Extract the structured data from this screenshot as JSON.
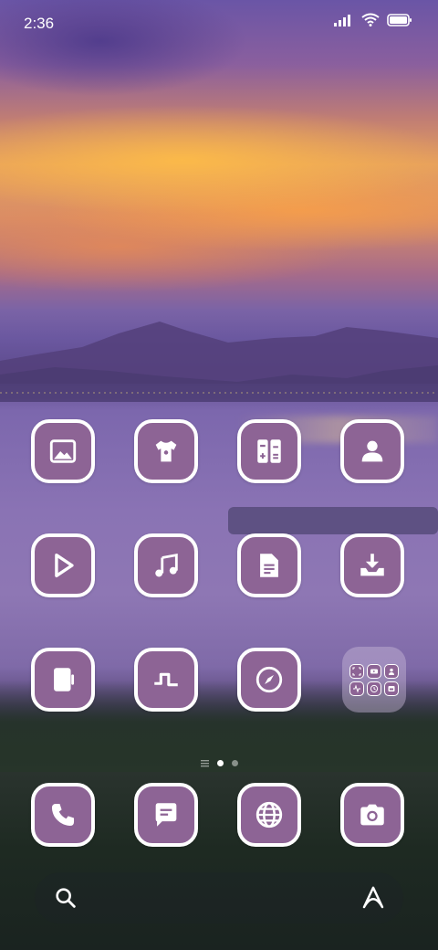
{
  "status_bar": {
    "time": "2:36",
    "icons": [
      "signal-icon",
      "wifi-icon",
      "battery-icon"
    ]
  },
  "home_screen": {
    "rows": [
      [
        {
          "name": "gallery-app",
          "icon": "image-icon"
        },
        {
          "name": "themes-app",
          "icon": "tshirt-icon"
        },
        {
          "name": "calculator-app",
          "icon": "calculator-icon"
        },
        {
          "name": "contacts-app",
          "icon": "person-icon"
        }
      ],
      [
        {
          "name": "video-app",
          "icon": "play-icon"
        },
        {
          "name": "music-app",
          "icon": "music-note-icon"
        },
        {
          "name": "notes-app",
          "icon": "document-icon"
        },
        {
          "name": "downloads-app",
          "icon": "download-icon"
        }
      ],
      [
        {
          "name": "notebook-app",
          "icon": "notebook-icon"
        },
        {
          "name": "pulse-app",
          "icon": "pulse-icon"
        },
        {
          "name": "compass-app",
          "icon": "compass-icon"
        },
        {
          "name": "app-folder",
          "icon": "folder-grid-icon"
        }
      ]
    ],
    "folder_icons": [
      "scan-icon",
      "youtube-icon",
      "contacts-icon",
      "activity-icon",
      "clock-icon",
      "store-icon"
    ],
    "page_indicator": {
      "pages": 2,
      "active": 1,
      "has_list_indicator": true
    },
    "dock": [
      {
        "name": "phone-app",
        "icon": "phone-icon"
      },
      {
        "name": "messages-app",
        "icon": "message-icon"
      },
      {
        "name": "browser-app",
        "icon": "globe-icon"
      },
      {
        "name": "camera-app",
        "icon": "camera-icon"
      }
    ]
  },
  "search_bar": {
    "left_icon": "search-icon",
    "right_icon": "assistant-icon"
  },
  "colors": {
    "icon_fill": "#8d6495",
    "icon_border": "#ffffff"
  }
}
